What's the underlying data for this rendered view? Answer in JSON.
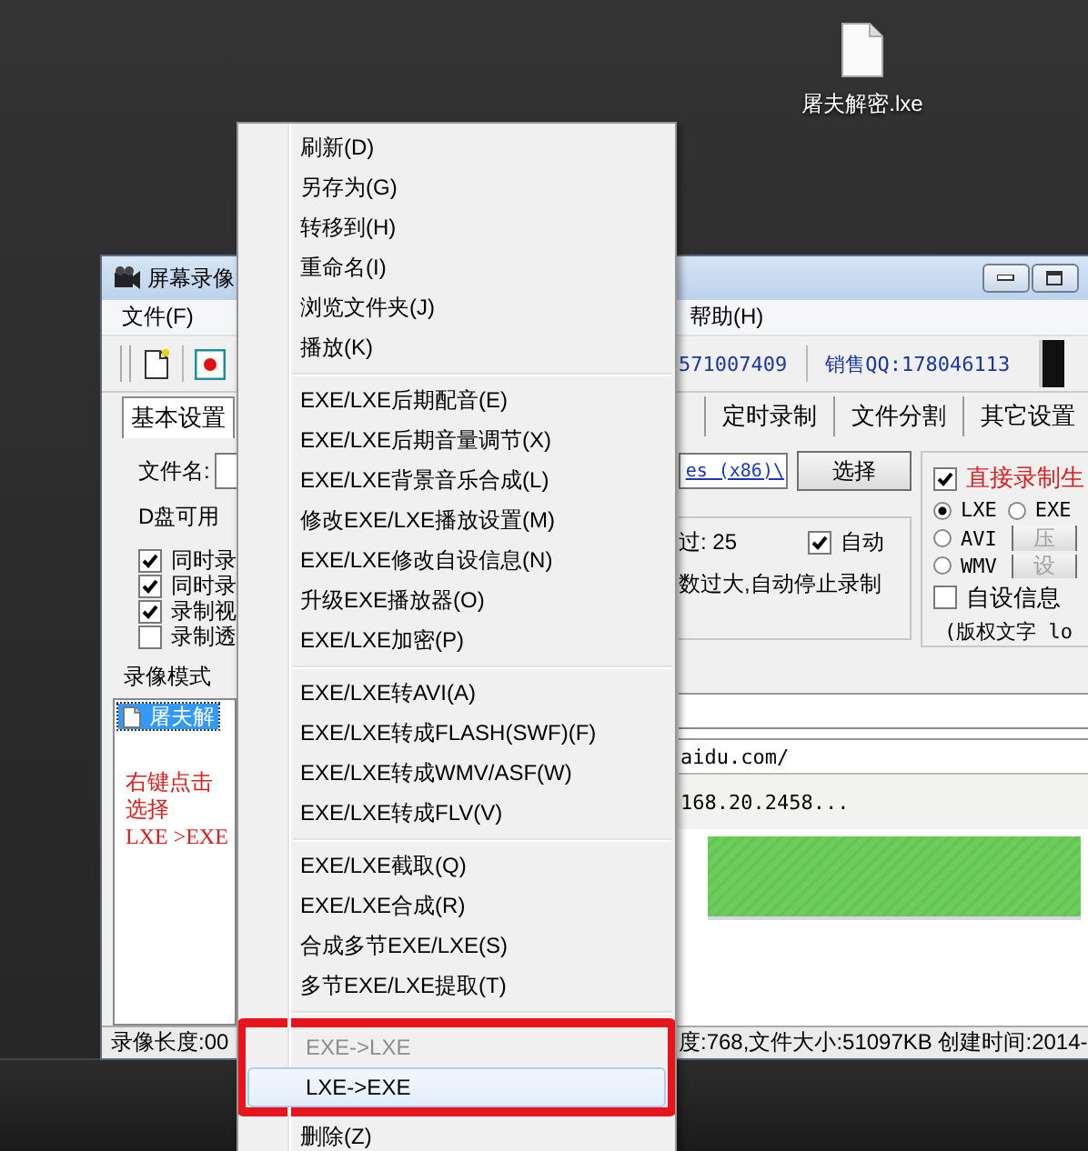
{
  "desktop_icons": [
    {
      "label": "屠夫解密.lxe"
    }
  ],
  "window": {
    "title": "屏幕录像",
    "menu_left": [
      "文件(F)"
    ],
    "menu_right": [
      "帮助(H)"
    ],
    "toolbar": {
      "phone": "571007409",
      "sales_qq": "销售QQ:178046113"
    },
    "tabs": [
      {
        "label": "基本设置",
        "selected": true
      },
      {
        "label": "定时录制",
        "selected": false
      },
      {
        "label": "文件分割",
        "selected": false
      },
      {
        "label": "其它设置",
        "selected": false
      }
    ],
    "file_name_label": "文件名:",
    "disk_space": "D盘可用",
    "options": [
      {
        "label": "同时录",
        "checked": true
      },
      {
        "label": "同时录",
        "checked": true
      },
      {
        "label": "录制视",
        "checked": true
      },
      {
        "label": "录制透",
        "checked": false
      }
    ],
    "path_value": "es (x86)\\",
    "choose_button": "选择",
    "frame_rate": "过: 25",
    "auto": {
      "label": "自动",
      "checked": true
    },
    "auto_stop_note": "数过大,自动停止录制",
    "direct": {
      "label": "直接录制生",
      "checked": true
    },
    "formats": [
      {
        "label": "LXE",
        "selected": true
      },
      {
        "label": "EXE",
        "selected": false
      },
      {
        "label": "AVI",
        "selected": false,
        "button": {
          "label": "压",
          "disabled": true
        }
      },
      {
        "label": "WMV",
        "selected": false,
        "button": {
          "label": "设",
          "disabled": true
        }
      }
    ],
    "custom_info": {
      "label": "自设信息",
      "checked": false
    },
    "copyright": "(版权文字 lo",
    "mode_label": "录像模式",
    "files": [
      {
        "name": "屠夫解",
        "selected": true
      }
    ],
    "note": [
      "右键点击",
      "选择",
      "LXE >EXE"
    ],
    "preview": {
      "address": "aidu.com/",
      "status": "168.20.2458..."
    },
    "status_left": "录像长度:00",
    "status_right": "度:768,文件大小:51097KB 创建时间:2014-"
  },
  "context_menu": {
    "items": [
      {
        "kind": "item",
        "label": "刷新(D)",
        "disabled": false,
        "selected": false,
        "framed": false
      },
      {
        "kind": "item",
        "label": "另存为(G)",
        "disabled": false,
        "selected": false,
        "framed": false
      },
      {
        "kind": "item",
        "label": "转移到(H)",
        "disabled": false,
        "selected": false,
        "framed": false
      },
      {
        "kind": "item",
        "label": "重命名(I)",
        "disabled": false,
        "selected": false,
        "framed": false
      },
      {
        "kind": "item",
        "label": "浏览文件夹(J)",
        "disabled": false,
        "selected": false,
        "framed": false
      },
      {
        "kind": "item",
        "label": "播放(K)",
        "disabled": false,
        "selected": false,
        "framed": false
      },
      {
        "kind": "separator"
      },
      {
        "kind": "item",
        "label": "EXE/LXE后期配音(E)",
        "disabled": false,
        "selected": false,
        "framed": false
      },
      {
        "kind": "item",
        "label": "EXE/LXE后期音量调节(X)",
        "disabled": false,
        "selected": false,
        "framed": false
      },
      {
        "kind": "item",
        "label": "EXE/LXE背景音乐合成(L)",
        "disabled": false,
        "selected": false,
        "framed": false
      },
      {
        "kind": "item",
        "label": "修改EXE/LXE播放设置(M)",
        "disabled": false,
        "selected": false,
        "framed": false
      },
      {
        "kind": "item",
        "label": "EXE/LXE修改自设信息(N)",
        "disabled": false,
        "selected": false,
        "framed": false
      },
      {
        "kind": "item",
        "label": "升级EXE播放器(O)",
        "disabled": false,
        "selected": false,
        "framed": false
      },
      {
        "kind": "item",
        "label": "EXE/LXE加密(P)",
        "disabled": false,
        "selected": false,
        "framed": false
      },
      {
        "kind": "separator"
      },
      {
        "kind": "item",
        "label": "EXE/LXE转AVI(A)",
        "disabled": false,
        "selected": false,
        "framed": false
      },
      {
        "kind": "item",
        "label": "EXE/LXE转成FLASH(SWF)(F)",
        "disabled": false,
        "selected": false,
        "framed": false
      },
      {
        "kind": "item",
        "label": "EXE/LXE转成WMV/ASF(W)",
        "disabled": false,
        "selected": false,
        "framed": false
      },
      {
        "kind": "item",
        "label": "EXE/LXE转成FLV(V)",
        "disabled": false,
        "selected": false,
        "framed": false
      },
      {
        "kind": "separator"
      },
      {
        "kind": "item",
        "label": "EXE/LXE截取(Q)",
        "disabled": false,
        "selected": false,
        "framed": false
      },
      {
        "kind": "item",
        "label": "EXE/LXE合成(R)",
        "disabled": false,
        "selected": false,
        "framed": false
      },
      {
        "kind": "item",
        "label": "合成多节EXE/LXE(S)",
        "disabled": false,
        "selected": false,
        "framed": false
      },
      {
        "kind": "item",
        "label": "多节EXE/LXE提取(T)",
        "disabled": false,
        "selected": false,
        "framed": false
      },
      {
        "kind": "separator"
      },
      {
        "kind": "item",
        "label": "EXE->LXE",
        "disabled": true,
        "selected": false,
        "framed": true
      },
      {
        "kind": "item",
        "label": "LXE->EXE",
        "disabled": false,
        "selected": true,
        "framed": true
      },
      {
        "kind": "item",
        "label": "删除(Z)",
        "disabled": false,
        "selected": false,
        "framed": false
      }
    ]
  }
}
